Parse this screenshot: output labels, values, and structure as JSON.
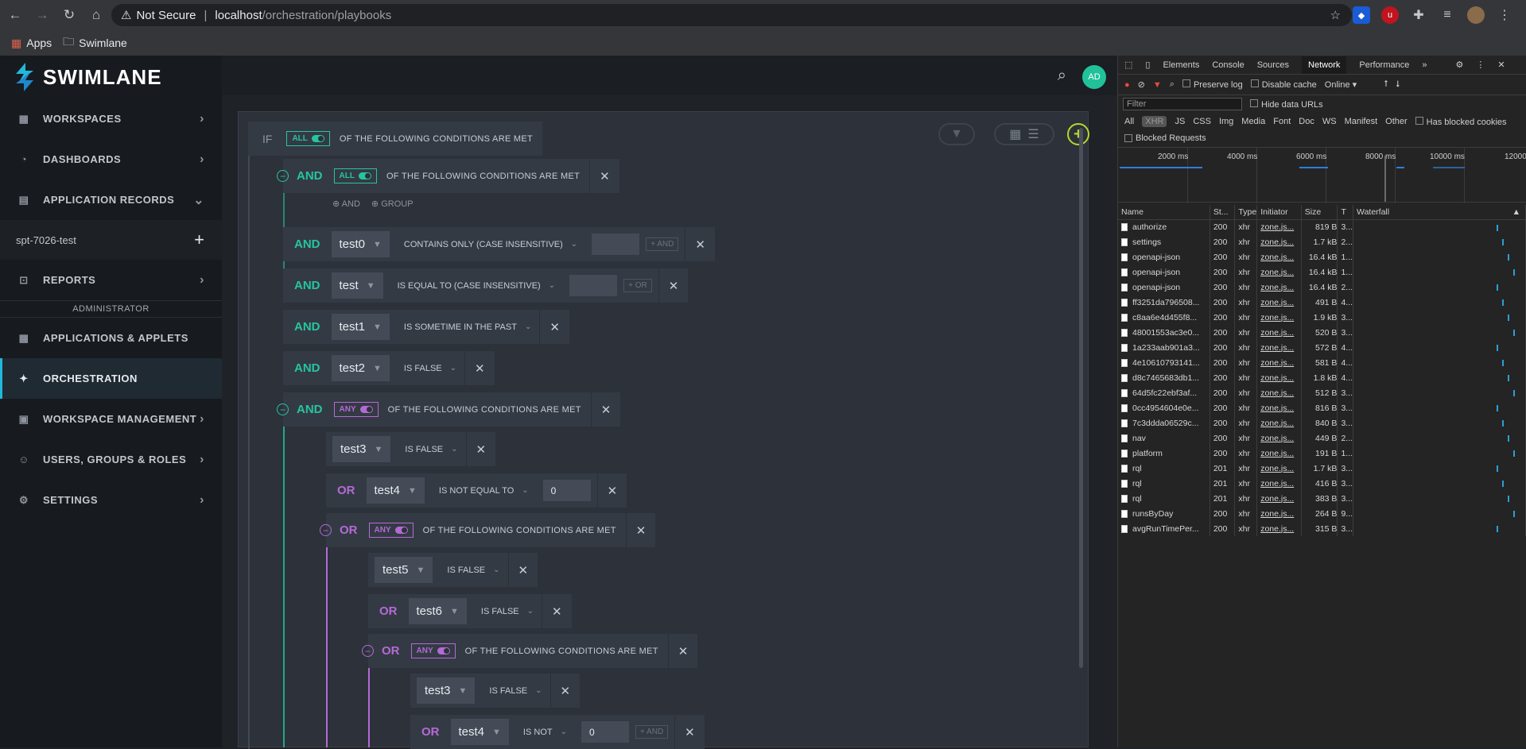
{
  "browser": {
    "not_secure": "Not Secure",
    "host": "localhost",
    "path": "/orchestration/playbooks",
    "bookmarks": [
      "Apps",
      "Swimlane"
    ]
  },
  "app": {
    "logo_text": "SWIMLANE",
    "avatar": "AD",
    "nav": {
      "workspaces": "WORKSPACES",
      "dashboards": "DASHBOARDS",
      "application_records": "APPLICATION RECORDS",
      "app_sub": "spt-7026-test",
      "reports": "REPORTS",
      "admin_header": "ADMINISTRATOR",
      "applications": "APPLICATIONS & APPLETS",
      "orchestration": "ORCHESTRATION",
      "workspace_mgmt": "WORKSPACE MANAGEMENT",
      "users": "USERS, GROUPS & ROLES",
      "settings": "SETTINGS"
    },
    "builder": {
      "if": "IF",
      "all": "ALL",
      "any": "ANY",
      "cond_text": "OF THE FOLLOWING CONDITIONS ARE MET",
      "and": "AND",
      "or": "OR",
      "group": "GROUP",
      "add_and": "+ AND",
      "add_or": "+ OR",
      "rows": [
        {
          "conj": "AND",
          "field": "test0",
          "op": "CONTAINS ONLY (CASE INSENSITIVE)",
          "add": "+ AND"
        },
        {
          "conj": "AND",
          "field": "test",
          "op": "IS EQUAL TO (CASE INSENSITIVE)",
          "add": "+ OR"
        },
        {
          "conj": "AND",
          "field": "test1",
          "op": "IS SOMETIME IN THE PAST"
        },
        {
          "conj": "AND",
          "field": "test2",
          "op": "IS FALSE"
        },
        {
          "conj": "",
          "field": "test3",
          "op": "IS FALSE"
        },
        {
          "conj": "OR",
          "field": "test4",
          "op": "IS NOT EQUAL TO",
          "value": "0"
        },
        {
          "conj": "",
          "field": "test5",
          "op": "IS FALSE"
        },
        {
          "conj": "OR",
          "field": "test6",
          "op": "IS FALSE"
        },
        {
          "conj": "",
          "field": "test3",
          "op": "IS FALSE"
        },
        {
          "conj": "OR",
          "field": "test4",
          "op": "IS NOT",
          "value": "0",
          "add": "+ AND"
        }
      ]
    }
  },
  "devtools": {
    "tabs": [
      "Elements",
      "Console",
      "Sources",
      "Network",
      "Performance"
    ],
    "preserve_log": "Preserve log",
    "disable_cache": "Disable cache",
    "online": "Online",
    "filter_placeholder": "Filter",
    "hide_data_urls": "Hide data URLs",
    "types": [
      "All",
      "XHR",
      "JS",
      "CSS",
      "Img",
      "Media",
      "Font",
      "Doc",
      "WS",
      "Manifest",
      "Other"
    ],
    "has_blocked_cookies": "Has blocked cookies",
    "blocked_requests": "Blocked Requests",
    "ticks": [
      "2000 ms",
      "4000 ms",
      "6000 ms",
      "8000 ms",
      "10000 ms",
      "12000"
    ],
    "columns": [
      "Name",
      "St...",
      "Type",
      "Initiator",
      "Size",
      "T",
      "Waterfall"
    ],
    "requests": [
      {
        "name": "authorize",
        "status": "200",
        "type": "xhr",
        "init": "zone.js...",
        "size": "819 B",
        "t": "3..."
      },
      {
        "name": "settings",
        "status": "200",
        "type": "xhr",
        "init": "zone.js...",
        "size": "1.7 kB",
        "t": "2..."
      },
      {
        "name": "openapi-json",
        "status": "200",
        "type": "xhr",
        "init": "zone.js...",
        "size": "16.4 kB",
        "t": "1..."
      },
      {
        "name": "openapi-json",
        "status": "200",
        "type": "xhr",
        "init": "zone.js...",
        "size": "16.4 kB",
        "t": "1..."
      },
      {
        "name": "openapi-json",
        "status": "200",
        "type": "xhr",
        "init": "zone.js...",
        "size": "16.4 kB",
        "t": "2..."
      },
      {
        "name": "ff3251da796508...",
        "status": "200",
        "type": "xhr",
        "init": "zone.js...",
        "size": "491 B",
        "t": "4..."
      },
      {
        "name": "c8aa6e4d455f8...",
        "status": "200",
        "type": "xhr",
        "init": "zone.js...",
        "size": "1.9 kB",
        "t": "3..."
      },
      {
        "name": "48001553ac3e0...",
        "status": "200",
        "type": "xhr",
        "init": "zone.js...",
        "size": "520 B",
        "t": "3..."
      },
      {
        "name": "1a233aab901a3...",
        "status": "200",
        "type": "xhr",
        "init": "zone.js...",
        "size": "572 B",
        "t": "4..."
      },
      {
        "name": "4e10610793141...",
        "status": "200",
        "type": "xhr",
        "init": "zone.js...",
        "size": "581 B",
        "t": "4..."
      },
      {
        "name": "d8c7465683db1...",
        "status": "200",
        "type": "xhr",
        "init": "zone.js...",
        "size": "1.8 kB",
        "t": "4..."
      },
      {
        "name": "64d5fc22ebf3af...",
        "status": "200",
        "type": "xhr",
        "init": "zone.js...",
        "size": "512 B",
        "t": "3..."
      },
      {
        "name": "0cc4954604e0e...",
        "status": "200",
        "type": "xhr",
        "init": "zone.js...",
        "size": "816 B",
        "t": "3..."
      },
      {
        "name": "7c3ddda06529c...",
        "status": "200",
        "type": "xhr",
        "init": "zone.js...",
        "size": "840 B",
        "t": "3..."
      },
      {
        "name": "nav",
        "status": "200",
        "type": "xhr",
        "init": "zone.js...",
        "size": "449 B",
        "t": "2..."
      },
      {
        "name": "platform",
        "status": "200",
        "type": "xhr",
        "init": "zone.js...",
        "size": "191 B",
        "t": "1..."
      },
      {
        "name": "rql",
        "status": "201",
        "type": "xhr",
        "init": "zone.js...",
        "size": "1.7 kB",
        "t": "3..."
      },
      {
        "name": "rql",
        "status": "201",
        "type": "xhr",
        "init": "zone.js...",
        "size": "416 B",
        "t": "3..."
      },
      {
        "name": "rql",
        "status": "201",
        "type": "xhr",
        "init": "zone.js...",
        "size": "383 B",
        "t": "3..."
      },
      {
        "name": "runsByDay",
        "status": "200",
        "type": "xhr",
        "init": "zone.js...",
        "size": "264 B",
        "t": "9..."
      },
      {
        "name": "avgRunTimePer...",
        "status": "200",
        "type": "xhr",
        "init": "zone.js...",
        "size": "315 B",
        "t": "3..."
      }
    ]
  },
  "colors": {
    "green": "#25c5a0",
    "purple": "#b46ad6",
    "accent": "#23b7d9",
    "add": "#b6d72b"
  }
}
